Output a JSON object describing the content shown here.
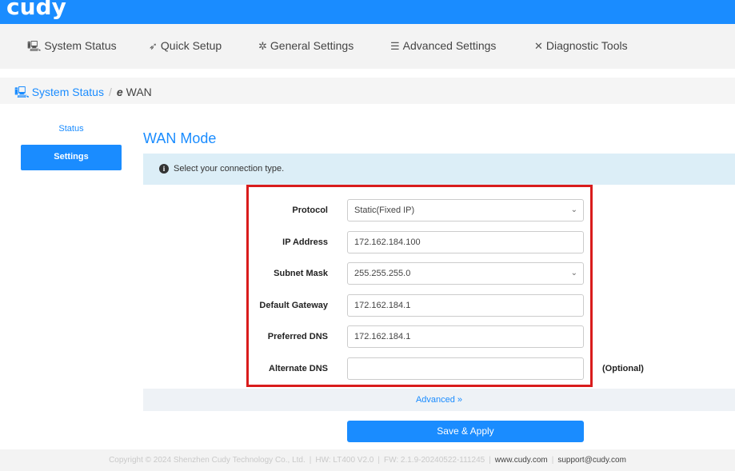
{
  "brand": {
    "logo": "cudy",
    "primary_color": "#1a8cff"
  },
  "nav": [
    {
      "icon": "monitor-icon",
      "label": "System Status"
    },
    {
      "icon": "rocket-icon",
      "label": "Quick Setup"
    },
    {
      "icon": "gear-icon",
      "label": "General Settings"
    },
    {
      "icon": "sliders-icon",
      "label": "Advanced Settings"
    },
    {
      "icon": "tools-icon",
      "label": "Diagnostic Tools"
    }
  ],
  "breadcrumb": {
    "parent": "System Status",
    "separator": "/",
    "current": "WAN"
  },
  "sidebar": {
    "status": "Status",
    "settings": "Settings"
  },
  "main": {
    "title": "WAN Mode",
    "info": "Select your connection type.",
    "fields": {
      "protocol": {
        "label": "Protocol",
        "value": "Static(Fixed IP)"
      },
      "ip": {
        "label": "IP Address",
        "value": "172.162.184.100"
      },
      "subnet": {
        "label": "Subnet Mask",
        "value": "255.255.255.0"
      },
      "gateway": {
        "label": "Default Gateway",
        "value": "172.162.184.1"
      },
      "dns1": {
        "label": "Preferred DNS",
        "value": "172.162.184.1"
      },
      "dns2": {
        "label": "Alternate DNS",
        "value": "",
        "suffix": "(Optional)"
      }
    },
    "advanced": "Advanced »",
    "save": "Save & Apply"
  },
  "footer": {
    "copyright": "Copyright © 2024 Shenzhen Cudy Technology Co., Ltd.",
    "hw": "HW: LT400 V2.0",
    "fw": "FW: 2.1.9-20240522-111245",
    "site": "www.cudy.com",
    "email": "support@cudy.com"
  }
}
